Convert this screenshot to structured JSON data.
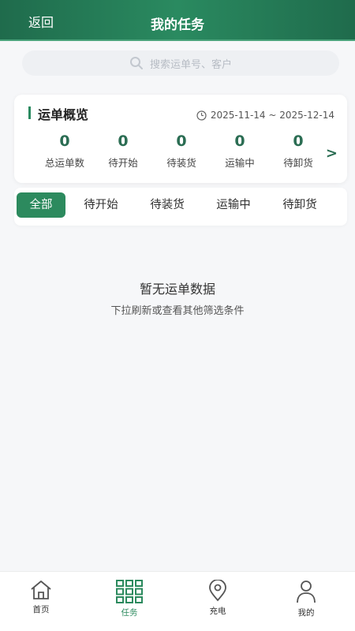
{
  "header": {
    "back_label": "返回",
    "title": "我的任务"
  },
  "search": {
    "placeholder": "搜索运单号、客户"
  },
  "overview": {
    "title": "运单概览",
    "date_range": "2025-11-14 ~ 2025-12-14",
    "stats": [
      {
        "value": "0",
        "label": "总运单数"
      },
      {
        "value": "0",
        "label": "待开始"
      },
      {
        "value": "0",
        "label": "待装货"
      },
      {
        "value": "0",
        "label": "运输中"
      },
      {
        "value": "0",
        "label": "待卸货"
      }
    ],
    "more_glyph": ">"
  },
  "filter_tabs": [
    {
      "label": "全部",
      "active": true
    },
    {
      "label": "待开始"
    },
    {
      "label": "待装货"
    },
    {
      "label": "运输中"
    },
    {
      "label": "待卸货"
    }
  ],
  "empty": {
    "title": "暂无运单数据",
    "subtitle": "下拉刷新或查看其他筛选条件"
  },
  "bottom_nav": [
    {
      "label": "首页",
      "icon": "home-icon"
    },
    {
      "label": "任务",
      "icon": "grid-icon",
      "active": true
    },
    {
      "label": "充电",
      "icon": "location-pin-icon"
    },
    {
      "label": "我的",
      "icon": "user-icon"
    }
  ],
  "colors": {
    "primary": "#2c8a5e",
    "header": "#1f6b4c",
    "stat": "#2b6d53"
  }
}
